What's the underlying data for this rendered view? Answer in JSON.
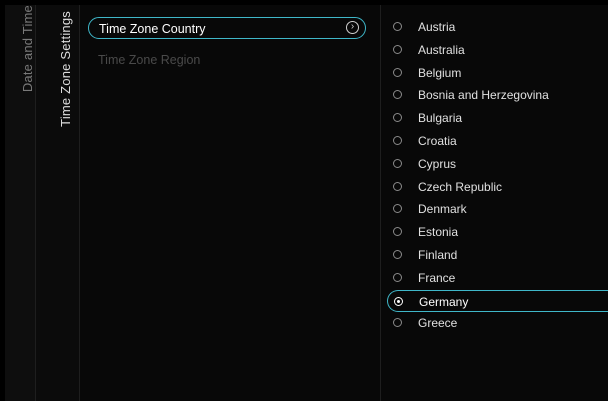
{
  "sidebar": {
    "date_and_time": "Date and Time",
    "time_zone_settings": "Time Zone Settings"
  },
  "menu": {
    "country_label": "Time Zone Country",
    "region_label": "Time Zone Region"
  },
  "countries": [
    "Austria",
    "Australia",
    "Belgium",
    "Bosnia and Herzegovina",
    "Bulgaria",
    "Croatia",
    "Cyprus",
    "Czech Republic",
    "Denmark",
    "Estonia",
    "Finland",
    "France",
    "Germany",
    "Greece"
  ],
  "selected_country": "Germany",
  "colors": {
    "accent": "#3fb7c9",
    "background": "#080808"
  },
  "icons": {
    "chevron": "chevron-right-icon",
    "radio": "radio-button-icon"
  }
}
